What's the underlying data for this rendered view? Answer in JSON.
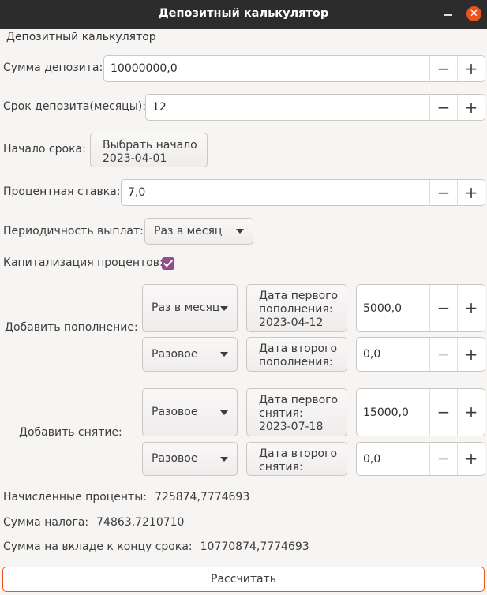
{
  "window": {
    "title": "Депозитный калькулятор",
    "minimize_icon": "minimize-icon",
    "close_icon": "close-icon",
    "close_glyph": "✕"
  },
  "menu": {
    "items": [
      "Депозитный калькулятор"
    ]
  },
  "deposit_amount": {
    "label": "Сумма депозита:",
    "value": "10000000,0"
  },
  "term": {
    "label": "Срок депозита(месяцы):",
    "value": "12"
  },
  "start": {
    "label": "Начало срока:",
    "button_label": "Выбрать начало\n2023-04-01"
  },
  "rate": {
    "label": "Процентная ставка:",
    "value": "7,0"
  },
  "payout": {
    "label": "Периодичность выплат:",
    "selected": "Раз в месяц"
  },
  "capitalization": {
    "label": "Капитализация процентов:",
    "checked": true
  },
  "replenishment": {
    "label": "Добавить пополнение:",
    "rows": [
      {
        "period": "Раз в месяц",
        "date_button": "Дата первого\nпополнения:\n2023-04-12",
        "amount": "5000,0"
      },
      {
        "period": "Разовое",
        "date_button": "Дата второго\nпополнения:",
        "amount": "0,0"
      }
    ]
  },
  "withdrawal": {
    "label": "Добавить снятие:",
    "rows": [
      {
        "period": "Разовое",
        "date_button": "Дата первого\nснятия:\n2023-07-18",
        "amount": "15000,0"
      },
      {
        "period": "Разовое",
        "date_button": "Дата второго\nснятия:",
        "amount": "0,0"
      }
    ]
  },
  "spin_glyphs": {
    "minus": "−",
    "plus": "+"
  },
  "results": {
    "interest": {
      "label": "Начисленные проценты:",
      "value": "725874,7774693"
    },
    "tax": {
      "label": "Сумма налога:",
      "value": "74863,7210710"
    },
    "total": {
      "label": "Сумма на вкладе к концу срока:",
      "value": "10770874,7774693"
    }
  },
  "calculate_button": "Рассчитать",
  "colors": {
    "accent": "#e95420",
    "checkbox": "#924d8b",
    "titlebar": "#2c2c2c"
  }
}
